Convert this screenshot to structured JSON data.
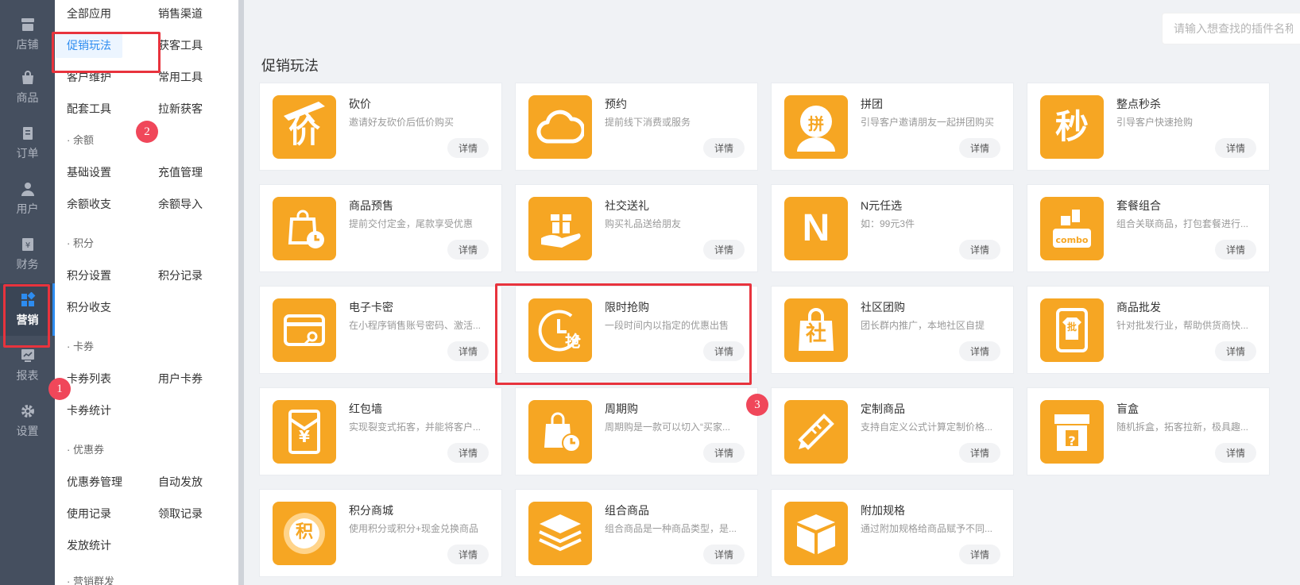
{
  "rail": [
    {
      "label": "店铺",
      "icon": "store-icon"
    },
    {
      "label": "商品",
      "icon": "bag-icon"
    },
    {
      "label": "订单",
      "icon": "order-icon"
    },
    {
      "label": "用户",
      "icon": "user-icon"
    },
    {
      "label": "财务",
      "icon": "finance-icon"
    },
    {
      "label": "营销",
      "icon": "marketing-icon",
      "active": true
    },
    {
      "label": "报表",
      "icon": "report-icon"
    },
    {
      "label": "设置",
      "icon": "settings-icon"
    }
  ],
  "submenu": {
    "top": [
      [
        "全部应用",
        "销售渠道"
      ],
      [
        "促销玩法",
        "获客工具"
      ],
      [
        "客户维护",
        "常用工具"
      ],
      [
        "配套工具",
        "拉新获客"
      ]
    ],
    "balance": {
      "title": "· 余额",
      "rows": [
        [
          "基础设置",
          "充值管理"
        ],
        [
          "余额收支",
          "余额导入"
        ]
      ]
    },
    "points": {
      "title": "· 积分",
      "rows": [
        [
          "积分设置",
          "积分记录"
        ],
        [
          "积分收支",
          ""
        ]
      ]
    },
    "cards": {
      "title": "· 卡券",
      "rows": [
        [
          "卡券列表",
          "用户卡券"
        ],
        [
          "卡券统计",
          ""
        ]
      ]
    },
    "coupons": {
      "title": "· 优惠券",
      "rows": [
        [
          "优惠券管理",
          "自动发放"
        ],
        [
          "使用记录",
          "领取记录"
        ],
        [
          "发放统计",
          ""
        ]
      ]
    },
    "more": "· 营销群发"
  },
  "search": {
    "placeholder": "请输入想查找的插件名称"
  },
  "section_title": "促销玩法",
  "detail_label": "详情",
  "cards": [
    {
      "name": "砍价",
      "desc": "邀请好友砍价后低价购买",
      "icon": "bargain-icon"
    },
    {
      "name": "预约",
      "desc": "提前线下消费或服务",
      "icon": "cloud-icon"
    },
    {
      "name": "拼团",
      "desc": "引导客户邀请朋友一起拼团购买",
      "icon": "group-buy-icon"
    },
    {
      "name": "整点秒杀",
      "desc": "引导客户快速抢购",
      "icon": "flash-sale-icon"
    },
    {
      "name": "商品预售",
      "desc": "提前交付定金，尾款享受优惠",
      "icon": "presale-icon"
    },
    {
      "name": "社交送礼",
      "desc": "购买礼品送给朋友",
      "icon": "gift-icon"
    },
    {
      "name": "N元任选",
      "desc": "如：99元3件",
      "icon": "n-icon"
    },
    {
      "name": "套餐组合",
      "desc": "组合关联商品，打包套餐进行...",
      "icon": "combo-icon"
    },
    {
      "name": "电子卡密",
      "desc": "在小程序销售账号密码、激活...",
      "icon": "card-key-icon"
    },
    {
      "name": "限时抢购",
      "desc": "一段时间内以指定的优惠出售",
      "icon": "limited-time-icon"
    },
    {
      "name": "社区团购",
      "desc": "团长群内推广，本地社区自提",
      "icon": "community-icon"
    },
    {
      "name": "商品批发",
      "desc": "针对批发行业，帮助供货商快...",
      "icon": "wholesale-icon"
    },
    {
      "name": "红包墙",
      "desc": "实现裂变式拓客，并能将客户...",
      "icon": "red-envelope-icon"
    },
    {
      "name": "周期购",
      "desc": "周期购是一款可以切入“买家...",
      "icon": "periodic-icon"
    },
    {
      "name": "定制商品",
      "desc": "支持自定义公式计算定制价格...",
      "icon": "custom-icon"
    },
    {
      "name": "盲盒",
      "desc": "随机拆盒，拓客拉新，极具趣...",
      "icon": "blind-box-icon"
    },
    {
      "name": "积分商城",
      "desc": "使用积分或积分+现金兑换商品",
      "icon": "points-mall-icon"
    },
    {
      "name": "组合商品",
      "desc": "组合商品是一种商品类型，是...",
      "icon": "layers-icon"
    },
    {
      "name": "附加规格",
      "desc": "通过附加规格给商品赋予不同...",
      "icon": "box-icon"
    }
  ],
  "icon_text": {
    "bargain": "价",
    "group": "拼",
    "flash": "秒",
    "n": "N",
    "combo": "combo",
    "community": "社",
    "wholesale": "批",
    "limited": "抢",
    "points": "积",
    "blind": "?",
    "yen": "¥"
  },
  "markers": [
    "1",
    "2",
    "3"
  ],
  "colors": {
    "accent": "#f6a623",
    "rail": "#454f5f",
    "link": "#2d8cf0",
    "annotation": "#e8333d"
  }
}
